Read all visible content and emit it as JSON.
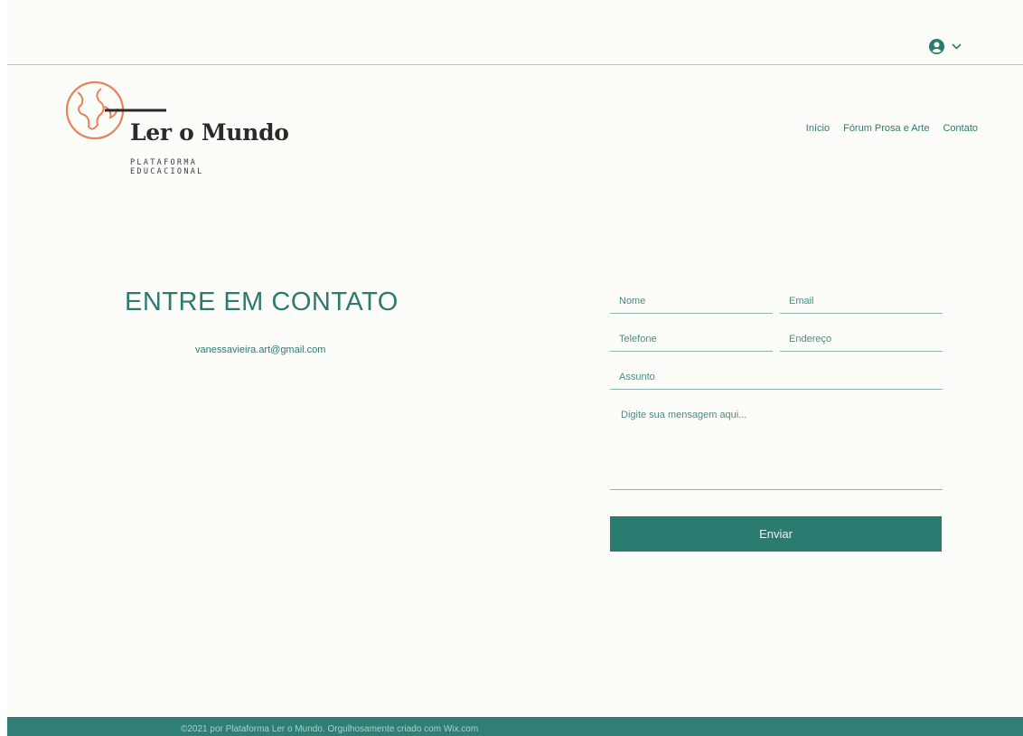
{
  "header": {
    "account_icon": "user-circle-icon",
    "account_chevron_icon": "chevron-down-icon"
  },
  "logo": {
    "name": "Ler o Mundo",
    "subtitle_line1": "PLATAFORMA",
    "subtitle_line2": "EDUCACIONAL",
    "icon": "globe-icon",
    "accent_color": "#e8825a"
  },
  "nav": {
    "items": [
      {
        "label": "Início"
      },
      {
        "label": "Fórum Prosa e Arte"
      },
      {
        "label": "Contato"
      }
    ]
  },
  "contact": {
    "title": "ENTRE EM CONTATO",
    "email": "vanessavieira.art@gmail.com"
  },
  "form": {
    "name_placeholder": "Nome",
    "email_placeholder": "Email",
    "phone_placeholder": "Telefone",
    "address_placeholder": "Endereço",
    "subject_placeholder": "Assunto",
    "message_placeholder": "Digite sua mensagem aqui...",
    "submit_label": "Enviar"
  },
  "footer": {
    "text": "©2021 por Plataforma Ler o Mundo. Orgulhosamente criado com Wix.com"
  },
  "colors": {
    "brand": "#2a7b70",
    "background": "#fcfcf9"
  }
}
